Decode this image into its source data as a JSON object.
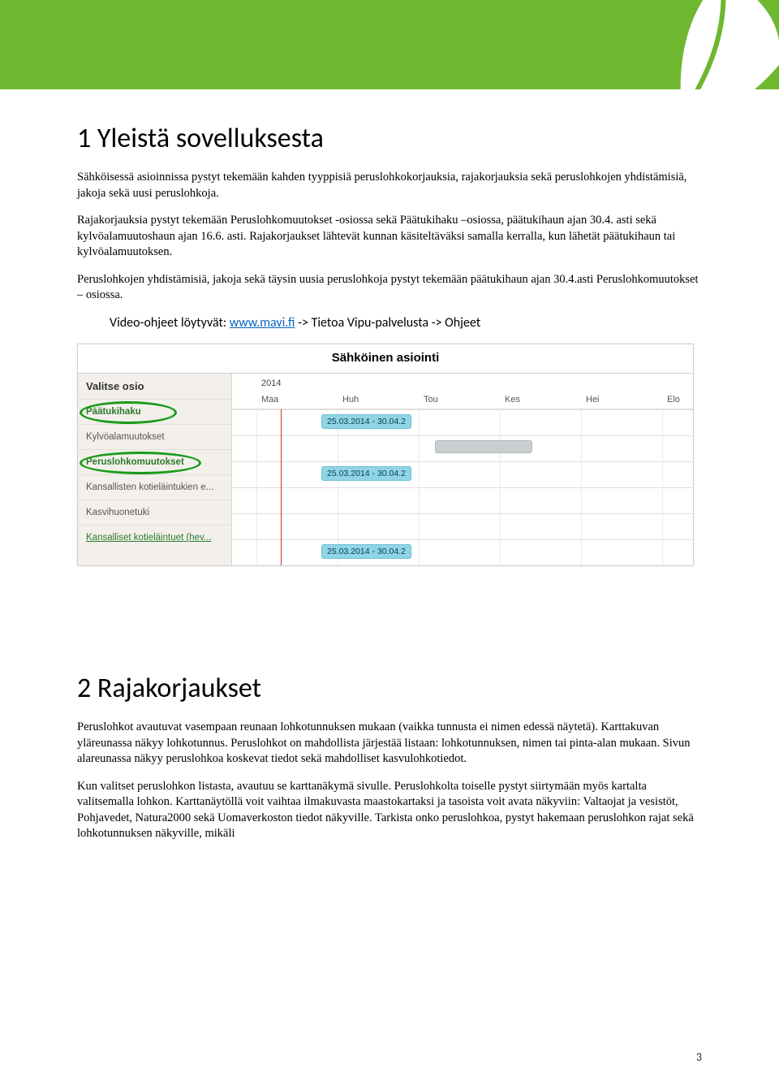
{
  "section1": {
    "title": "1 Yleistä sovelluksesta",
    "p1": "Sähköisessä asioinnissa pystyt tekemään kahden tyyppisiä peruslohkokorjauksia, rajakorjauksia sekä peruslohkojen yhdistämisiä, jakoja sekä uusi peruslohkoja.",
    "p2": "Rajakorjauksia pystyt tekemään Peruslohkomuutokset -osiossa sekä Päätukihaku –osiossa, päätukihaun ajan 30.4. asti sekä kylvöalamuutoshaun ajan 16.6. asti. Rajakorjaukset lähtevät kunnan käsiteltäväksi samalla kerralla, kun lähetät päätukihaun tai kylvöalamuutoksen.",
    "p3": "Peruslohkojen yhdistämisiä, jakoja sekä täysin uusia peruslohkoja pystyt tekemään päätukihaun ajan 30.4.asti Peruslohkomuutokset – osiossa.",
    "video_prefix": "Video-ohjeet löytyvät: ",
    "video_link": "www.mavi.fi",
    "video_suffix": " -> Tietoa Vipu-palvelusta -> Ohjeet"
  },
  "screenshot": {
    "title": "Sähköinen asiointi",
    "side_head": "Valitse osio",
    "rows": [
      "Päätukihaku",
      "Kylvöalamuutokset",
      "Peruslohkomuutokset",
      "Kansallisten kotieläintukien e...",
      "Kasvihuonetuki",
      "Kansalliset kotieläintuet (hev..."
    ],
    "year": "2014",
    "months": [
      "Maa",
      "Huh",
      "Tou",
      "Kes",
      "Hei",
      "Elo"
    ],
    "tag1": "25.03.2014 - 30.04.2",
    "tag2": "25.03.2014 - 30.04.2",
    "tag3": "25.03.2014 - 30.04.2"
  },
  "section2": {
    "title": "2 Rajakorjaukset",
    "p1": "Peruslohkot avautuvat vasempaan reunaan lohkotunnuksen mukaan (vaikka tunnusta ei nimen edessä näytetä). Karttakuvan yläreunassa näkyy lohkotunnus. Peruslohkot on mahdollista järjestää listaan: lohkotunnuksen, nimen tai pinta-alan mukaan. Sivun alareunassa näkyy peruslohkoa koskevat tiedot sekä mahdolliset kasvulohkotiedot.",
    "p2": "Kun valitset peruslohkon listasta, avautuu se karttanäkymä sivulle. Peruslohkolta toiselle pystyt siirtymään myös kartalta valitsemalla lohkon. Karttanäytöllä voit vaihtaa ilmakuvasta maastokartaksi ja tasoista voit avata näkyviin: Valtaojat ja vesistöt, Pohjavedet, Natura2000 sekä Uomaverkoston tiedot näkyville. Tarkista onko peruslohkoa, pystyt hakemaan peruslohkon rajat sekä lohkotunnuksen näkyville, mikäli"
  },
  "page": "3"
}
